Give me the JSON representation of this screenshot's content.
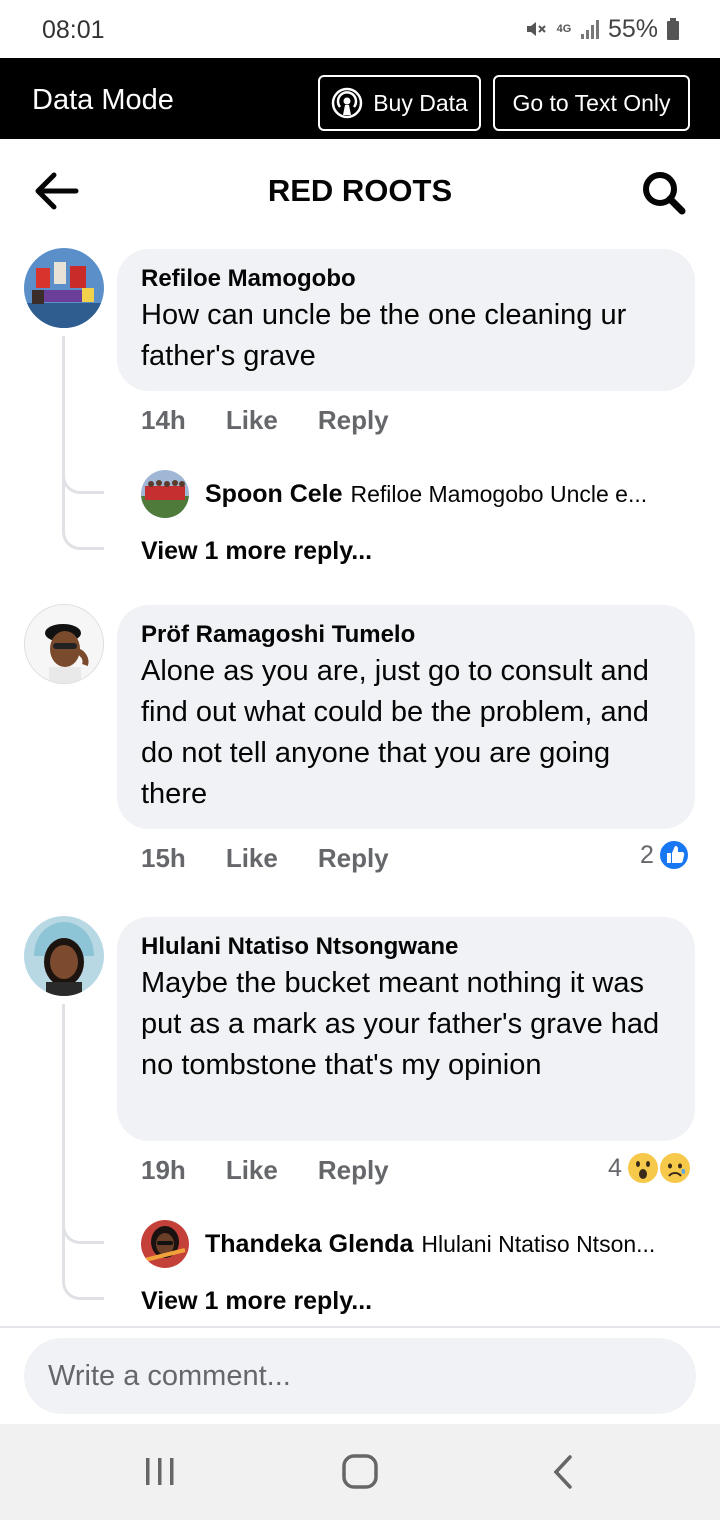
{
  "status": {
    "time": "08:01",
    "battery": "55%",
    "network": "4G"
  },
  "data_bar": {
    "title": "Data Mode",
    "buy_label": "Buy Data",
    "text_only_label": "Go to Text Only"
  },
  "header": {
    "title": "RED ROOTS"
  },
  "comments": [
    {
      "author": "Refiloe Mamogobo",
      "text": "How can uncle be the one cleaning ur father's grave",
      "time": "14h",
      "like": "Like",
      "reply": "Reply",
      "reply_preview": {
        "author": "Spoon Cele",
        "text": "Refiloe Mamogobo Uncle e..."
      },
      "more_replies": "View 1 more reply..."
    },
    {
      "author": "Pröf Ramagoshi Tumelo",
      "text": "Alone as you are, just go to consult and find out what could be the problem, and do not tell anyone that you are going there",
      "time": "15h",
      "like": "Like",
      "reply": "Reply",
      "reaction_count": "2"
    },
    {
      "author": "Hlulani Ntatiso Ntsongwane",
      "text": "Maybe the bucket meant nothing it was put as a mark as your father's grave had no tombstone  that's my opinion",
      "time": "19h",
      "like": "Like",
      "reply": "Reply",
      "reaction_count": "4",
      "reply_preview": {
        "author": "Thandeka Glenda",
        "text": "Hlulani Ntatiso Ntson..."
      },
      "more_replies": "View 1 more reply..."
    }
  ],
  "composer": {
    "placeholder": "Write a comment..."
  },
  "colors": {
    "accent": "#1877f2",
    "bubble": "#f0f2f5",
    "meta": "#65676b",
    "data_bar": "#000000"
  }
}
